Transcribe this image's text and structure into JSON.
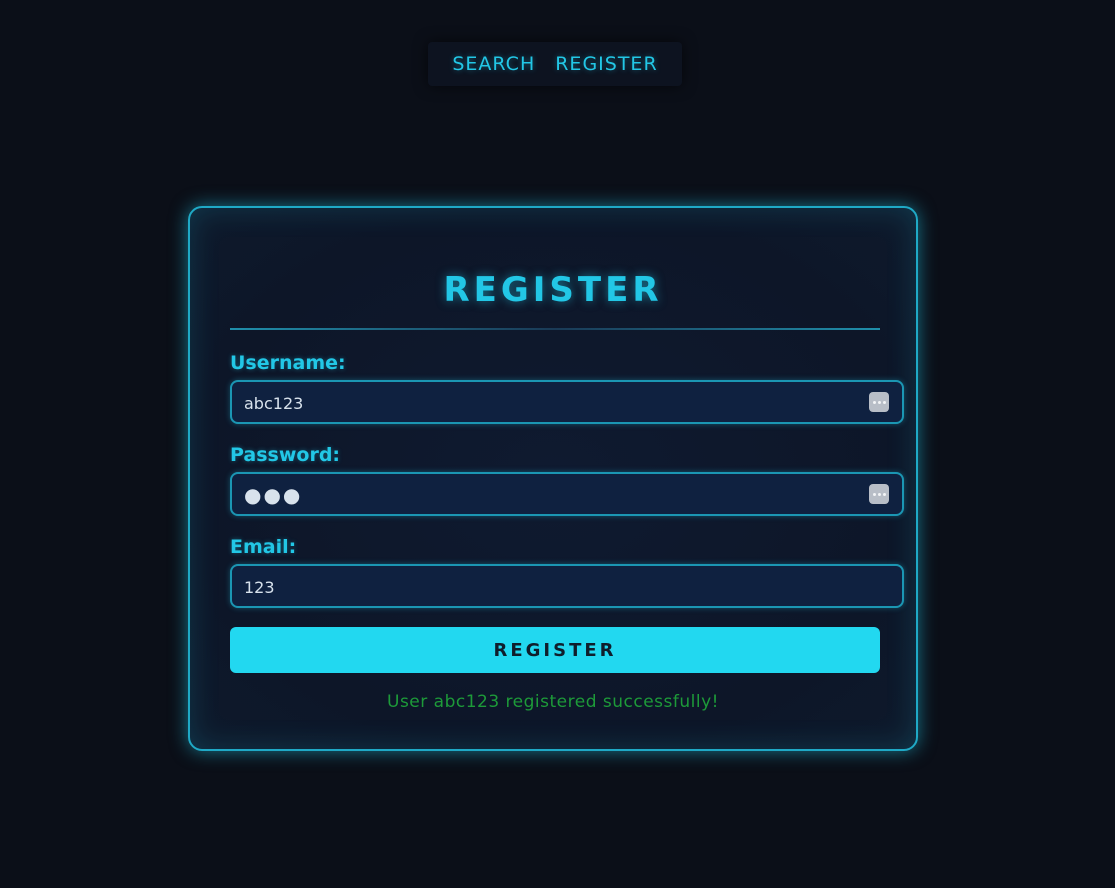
{
  "nav": {
    "items": [
      {
        "label": "SEARCH"
      },
      {
        "label": "REGISTER"
      }
    ]
  },
  "form": {
    "title": "REGISTER",
    "username": {
      "label": "Username:",
      "value": "abc123"
    },
    "password": {
      "label": "Password:",
      "value": "●●●"
    },
    "email": {
      "label": "Email:",
      "value": "123"
    },
    "submit_label": "REGISTER",
    "message": "User abc123 registered successfully!"
  },
  "colors": {
    "accent": "#22c7e6",
    "button": "#22d8f0",
    "success": "#1d9a39",
    "background": "#0b0f18"
  },
  "icons": {
    "password_manager": "password-manager-key-icon"
  }
}
